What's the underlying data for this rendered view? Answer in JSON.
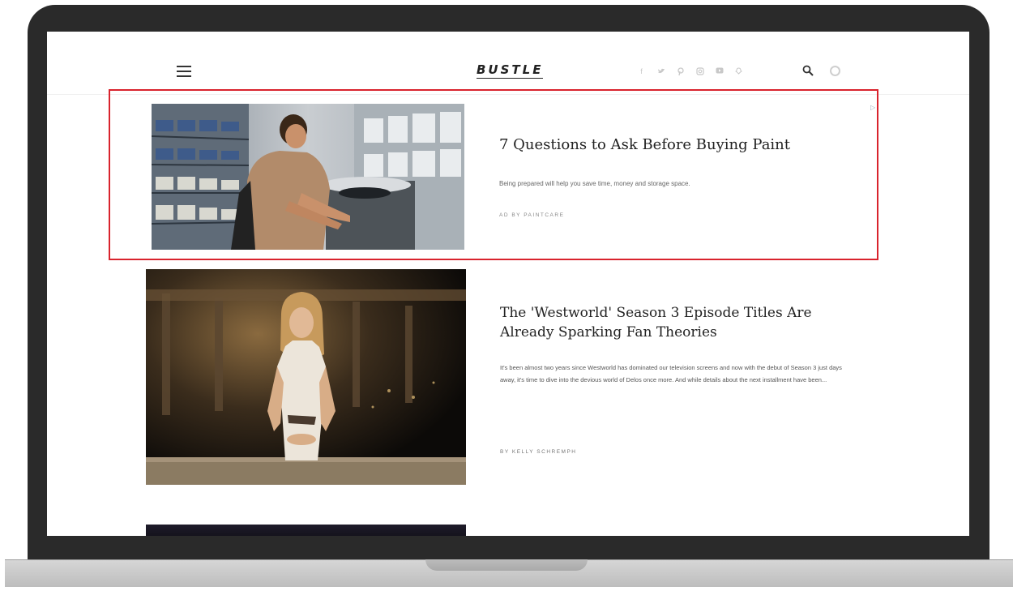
{
  "site": {
    "logo": "BUSTLE",
    "social_icons": [
      "facebook-icon",
      "twitter-icon",
      "pinterest-icon",
      "instagram-icon",
      "youtube-icon",
      "snapchat-icon"
    ]
  },
  "ad": {
    "title": "7 Questions to Ask Before Buying Paint",
    "description": "Being prepared will help you save time, money and storage space.",
    "byline": "AD BY PAINTCARE",
    "highlight_color": "#d9232d"
  },
  "article": {
    "title": "The 'Westworld' Season 3 Episode Titles Are Already Sparking Fan Theories",
    "description": "It's been almost two years since Westworld has dominated our television screens and now with the debut of Season 3 just days away, it's time to dive into the devious world of Delos once more. And while details about the next installment have been...",
    "byline": "BY KELLY SCHREMPH"
  }
}
